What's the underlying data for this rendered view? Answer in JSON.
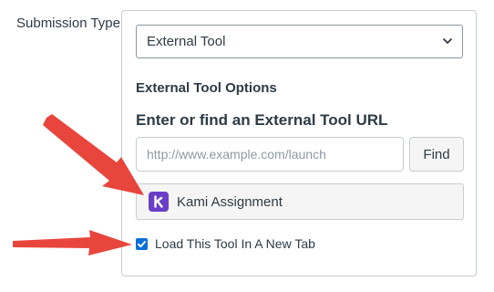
{
  "form": {
    "submission_type_label": "Submission Type",
    "submission_type_value": "External Tool"
  },
  "external_tool": {
    "options_heading": "External Tool Options",
    "url_heading": "Enter or find an External Tool URL",
    "url_placeholder": "http://www.example.com/launch",
    "url_value": "",
    "find_label": "Find",
    "selected_tool": {
      "name": "Kami Assignment",
      "logo_letter": "k",
      "logo_color": "#6A3FC7"
    },
    "new_tab_label": "Load This Tool In A New Tab",
    "new_tab_checked": true
  },
  "annotations": {
    "arrow_color": "#E8453C",
    "icons": [
      "arrow-to-selected-tool",
      "arrow-to-new-tab-checkbox"
    ]
  },
  "colors": {
    "checkbox": "#0B6FD6",
    "border": "#C7CDD1",
    "text": "#2D3B45"
  }
}
